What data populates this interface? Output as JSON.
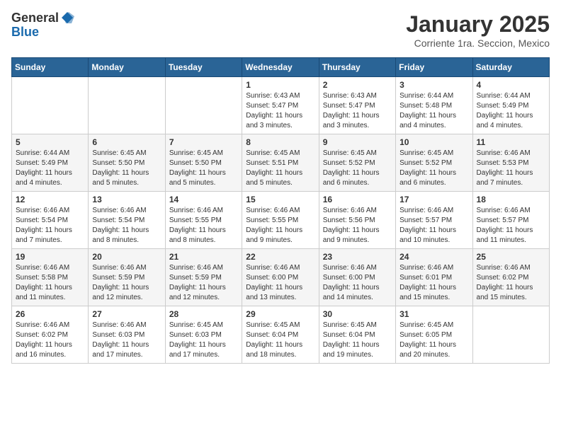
{
  "header": {
    "logo_general": "General",
    "logo_blue": "Blue",
    "month_title": "January 2025",
    "location": "Corriente 1ra. Seccion, Mexico"
  },
  "days_of_week": [
    "Sunday",
    "Monday",
    "Tuesday",
    "Wednesday",
    "Thursday",
    "Friday",
    "Saturday"
  ],
  "weeks": [
    [
      {
        "day": "",
        "sunrise": "",
        "sunset": "",
        "daylight": ""
      },
      {
        "day": "",
        "sunrise": "",
        "sunset": "",
        "daylight": ""
      },
      {
        "day": "",
        "sunrise": "",
        "sunset": "",
        "daylight": ""
      },
      {
        "day": "1",
        "sunrise": "Sunrise: 6:43 AM",
        "sunset": "Sunset: 5:47 PM",
        "daylight": "Daylight: 11 hours and 3 minutes."
      },
      {
        "day": "2",
        "sunrise": "Sunrise: 6:43 AM",
        "sunset": "Sunset: 5:47 PM",
        "daylight": "Daylight: 11 hours and 3 minutes."
      },
      {
        "day": "3",
        "sunrise": "Sunrise: 6:44 AM",
        "sunset": "Sunset: 5:48 PM",
        "daylight": "Daylight: 11 hours and 4 minutes."
      },
      {
        "day": "4",
        "sunrise": "Sunrise: 6:44 AM",
        "sunset": "Sunset: 5:49 PM",
        "daylight": "Daylight: 11 hours and 4 minutes."
      }
    ],
    [
      {
        "day": "5",
        "sunrise": "Sunrise: 6:44 AM",
        "sunset": "Sunset: 5:49 PM",
        "daylight": "Daylight: 11 hours and 4 minutes."
      },
      {
        "day": "6",
        "sunrise": "Sunrise: 6:45 AM",
        "sunset": "Sunset: 5:50 PM",
        "daylight": "Daylight: 11 hours and 5 minutes."
      },
      {
        "day": "7",
        "sunrise": "Sunrise: 6:45 AM",
        "sunset": "Sunset: 5:50 PM",
        "daylight": "Daylight: 11 hours and 5 minutes."
      },
      {
        "day": "8",
        "sunrise": "Sunrise: 6:45 AM",
        "sunset": "Sunset: 5:51 PM",
        "daylight": "Daylight: 11 hours and 5 minutes."
      },
      {
        "day": "9",
        "sunrise": "Sunrise: 6:45 AM",
        "sunset": "Sunset: 5:52 PM",
        "daylight": "Daylight: 11 hours and 6 minutes."
      },
      {
        "day": "10",
        "sunrise": "Sunrise: 6:45 AM",
        "sunset": "Sunset: 5:52 PM",
        "daylight": "Daylight: 11 hours and 6 minutes."
      },
      {
        "day": "11",
        "sunrise": "Sunrise: 6:46 AM",
        "sunset": "Sunset: 5:53 PM",
        "daylight": "Daylight: 11 hours and 7 minutes."
      }
    ],
    [
      {
        "day": "12",
        "sunrise": "Sunrise: 6:46 AM",
        "sunset": "Sunset: 5:54 PM",
        "daylight": "Daylight: 11 hours and 7 minutes."
      },
      {
        "day": "13",
        "sunrise": "Sunrise: 6:46 AM",
        "sunset": "Sunset: 5:54 PM",
        "daylight": "Daylight: 11 hours and 8 minutes."
      },
      {
        "day": "14",
        "sunrise": "Sunrise: 6:46 AM",
        "sunset": "Sunset: 5:55 PM",
        "daylight": "Daylight: 11 hours and 8 minutes."
      },
      {
        "day": "15",
        "sunrise": "Sunrise: 6:46 AM",
        "sunset": "Sunset: 5:55 PM",
        "daylight": "Daylight: 11 hours and 9 minutes."
      },
      {
        "day": "16",
        "sunrise": "Sunrise: 6:46 AM",
        "sunset": "Sunset: 5:56 PM",
        "daylight": "Daylight: 11 hours and 9 minutes."
      },
      {
        "day": "17",
        "sunrise": "Sunrise: 6:46 AM",
        "sunset": "Sunset: 5:57 PM",
        "daylight": "Daylight: 11 hours and 10 minutes."
      },
      {
        "day": "18",
        "sunrise": "Sunrise: 6:46 AM",
        "sunset": "Sunset: 5:57 PM",
        "daylight": "Daylight: 11 hours and 11 minutes."
      }
    ],
    [
      {
        "day": "19",
        "sunrise": "Sunrise: 6:46 AM",
        "sunset": "Sunset: 5:58 PM",
        "daylight": "Daylight: 11 hours and 11 minutes."
      },
      {
        "day": "20",
        "sunrise": "Sunrise: 6:46 AM",
        "sunset": "Sunset: 5:59 PM",
        "daylight": "Daylight: 11 hours and 12 minutes."
      },
      {
        "day": "21",
        "sunrise": "Sunrise: 6:46 AM",
        "sunset": "Sunset: 5:59 PM",
        "daylight": "Daylight: 11 hours and 12 minutes."
      },
      {
        "day": "22",
        "sunrise": "Sunrise: 6:46 AM",
        "sunset": "Sunset: 6:00 PM",
        "daylight": "Daylight: 11 hours and 13 minutes."
      },
      {
        "day": "23",
        "sunrise": "Sunrise: 6:46 AM",
        "sunset": "Sunset: 6:00 PM",
        "daylight": "Daylight: 11 hours and 14 minutes."
      },
      {
        "day": "24",
        "sunrise": "Sunrise: 6:46 AM",
        "sunset": "Sunset: 6:01 PM",
        "daylight": "Daylight: 11 hours and 15 minutes."
      },
      {
        "day": "25",
        "sunrise": "Sunrise: 6:46 AM",
        "sunset": "Sunset: 6:02 PM",
        "daylight": "Daylight: 11 hours and 15 minutes."
      }
    ],
    [
      {
        "day": "26",
        "sunrise": "Sunrise: 6:46 AM",
        "sunset": "Sunset: 6:02 PM",
        "daylight": "Daylight: 11 hours and 16 minutes."
      },
      {
        "day": "27",
        "sunrise": "Sunrise: 6:46 AM",
        "sunset": "Sunset: 6:03 PM",
        "daylight": "Daylight: 11 hours and 17 minutes."
      },
      {
        "day": "28",
        "sunrise": "Sunrise: 6:45 AM",
        "sunset": "Sunset: 6:03 PM",
        "daylight": "Daylight: 11 hours and 17 minutes."
      },
      {
        "day": "29",
        "sunrise": "Sunrise: 6:45 AM",
        "sunset": "Sunset: 6:04 PM",
        "daylight": "Daylight: 11 hours and 18 minutes."
      },
      {
        "day": "30",
        "sunrise": "Sunrise: 6:45 AM",
        "sunset": "Sunset: 6:04 PM",
        "daylight": "Daylight: 11 hours and 19 minutes."
      },
      {
        "day": "31",
        "sunrise": "Sunrise: 6:45 AM",
        "sunset": "Sunset: 6:05 PM",
        "daylight": "Daylight: 11 hours and 20 minutes."
      },
      {
        "day": "",
        "sunrise": "",
        "sunset": "",
        "daylight": ""
      }
    ]
  ]
}
